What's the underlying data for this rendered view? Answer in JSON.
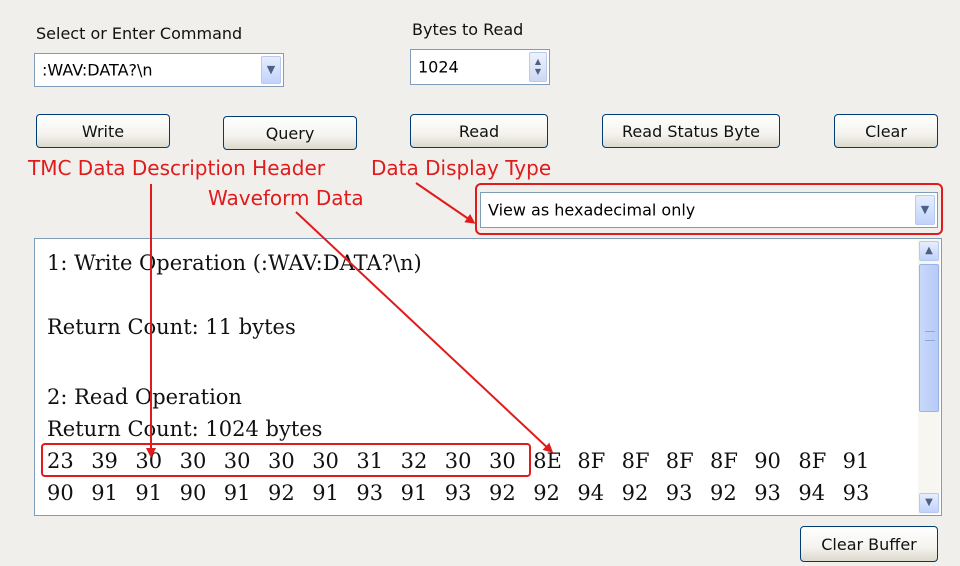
{
  "command": {
    "label": "Select or Enter Command",
    "value": ":WAV:DATA?\\n"
  },
  "bytes": {
    "label": "Bytes to Read",
    "value": "1024"
  },
  "buttons": {
    "write": "Write",
    "query": "Query",
    "read": "Read",
    "status": "Read Status Byte",
    "clear": "Clear",
    "clear_buffer": "Clear Buffer"
  },
  "display_type": {
    "value": "View as hexadecimal only"
  },
  "annotations": {
    "header": "TMC Data Description Header",
    "display_type": "Data Display Type",
    "waveform": "Waveform Data"
  },
  "output": {
    "line1": "1: Write Operation (:WAV:DATA?\\n)",
    "line2": "Return Count: 11 bytes",
    "line3": "2: Read Operation",
    "line4": "Return Count: 1024 bytes",
    "hex_row1": [
      "23",
      "39",
      "30",
      "30",
      "30",
      "30",
      "30",
      "31",
      "32",
      "30",
      "30",
      "8E",
      "8F",
      "8F",
      "8F",
      "8F",
      "90",
      "8F",
      "91"
    ],
    "hex_row2": [
      "90",
      "91",
      "91",
      "90",
      "91",
      "92",
      "91",
      "93",
      "91",
      "93",
      "92",
      "92",
      "94",
      "92",
      "93",
      "92",
      "93",
      "94",
      "93"
    ]
  },
  "colors": {
    "annotation": "#e01b1b",
    "border": "#7f9db9",
    "button_border": "#003c74"
  },
  "icons": [
    "chevron-down-icon",
    "spinner-up-down-icon",
    "scroll-up-icon",
    "scroll-down-icon"
  ]
}
